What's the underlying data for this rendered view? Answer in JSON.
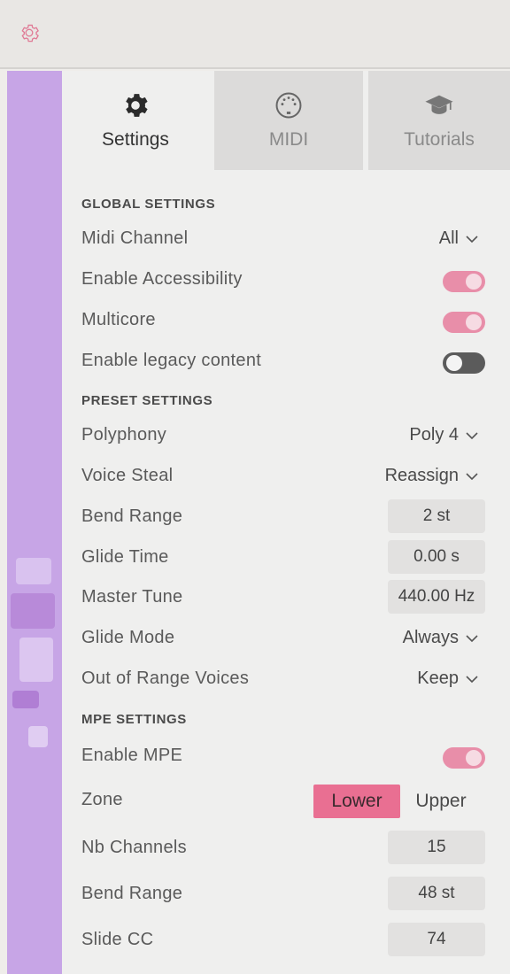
{
  "tabs": [
    {
      "label": "Settings",
      "icon": "gear-icon",
      "active": true
    },
    {
      "label": "MIDI",
      "icon": "midi-port-icon",
      "active": false
    },
    {
      "label": "Tutorials",
      "icon": "graduation-cap-icon",
      "active": false
    }
  ],
  "global": {
    "heading": "GLOBAL SETTINGS",
    "midi_channel": {
      "label": "Midi Channel",
      "value": "All"
    },
    "accessibility": {
      "label": "Enable Accessibility",
      "on": true
    },
    "multicore": {
      "label": "Multicore",
      "on": true
    },
    "legacy": {
      "label": "Enable legacy content",
      "on": false
    }
  },
  "preset": {
    "heading": "PRESET SETTINGS",
    "polyphony": {
      "label": "Polyphony",
      "value": "Poly 4"
    },
    "voice_steal": {
      "label": "Voice Steal",
      "value": "Reassign"
    },
    "bend_range": {
      "label": "Bend Range",
      "value": "2 st"
    },
    "glide_time": {
      "label": "Glide Time",
      "value": "0.00 s"
    },
    "master_tune": {
      "label": "Master Tune",
      "value": "440.00 Hz"
    },
    "glide_mode": {
      "label": "Glide Mode",
      "value": "Always"
    },
    "out_of_range": {
      "label": "Out of Range Voices",
      "value": "Keep"
    }
  },
  "mpe": {
    "heading": "MPE SETTINGS",
    "enable": {
      "label": "Enable MPE",
      "on": true
    },
    "zone": {
      "label": "Zone",
      "lower": "Lower",
      "upper": "Upper",
      "selected": "Lower"
    },
    "nb_channels": {
      "label": "Nb Channels",
      "value": "15"
    },
    "bend_range": {
      "label": "Bend Range",
      "value": "48 st"
    },
    "slide_cc": {
      "label": "Slide CC",
      "value": "74"
    }
  },
  "colors": {
    "accent_pink": "#e96f92",
    "toggle_on": "#e88ea9",
    "sidebar_purple": "#c7a5e6"
  }
}
